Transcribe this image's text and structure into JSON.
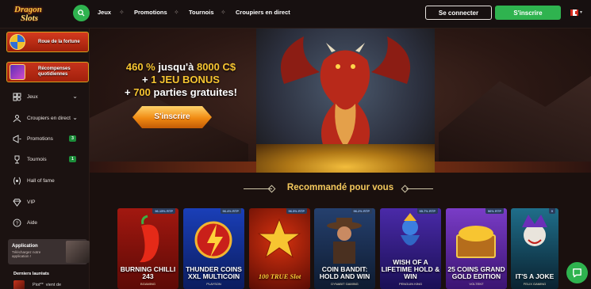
{
  "header": {
    "logo_line1": "Dragon",
    "logo_line2": "Slots",
    "nav": [
      "Jeux",
      "Promotions",
      "Tournois",
      "Croupiers en direct"
    ],
    "login_label": "Se connecter",
    "signup_label": "S'inscrire",
    "language_flag": "canada-flag-icon"
  },
  "sidebar": {
    "wheel_label": "Roue de la fortune",
    "daily_label": "Récompenses quotidiennes",
    "items": [
      {
        "label": "Jeux",
        "icon": "games-icon"
      },
      {
        "label": "Croupiers en direct",
        "icon": "live-dealer-icon"
      },
      {
        "label": "Promotions",
        "icon": "megaphone-icon",
        "badge": "3"
      },
      {
        "label": "Tournois",
        "icon": "trophy-icon",
        "badge": "1"
      },
      {
        "label": "Hall of fame",
        "icon": "laurel-icon"
      },
      {
        "label": "VIP",
        "icon": "diamond-icon"
      },
      {
        "label": "Aide",
        "icon": "help-icon"
      }
    ],
    "app": {
      "title": "Application",
      "subtitle": "Téléchargez notre application !"
    },
    "winners_title": "Derniers lauréats",
    "winner": {
      "name": "Piot**",
      "text": "vient de"
    }
  },
  "hero": {
    "line1_a": "460 %",
    "line1_b": " jusqu'à ",
    "line1_c": "8000 C$",
    "line2_a": "+ ",
    "line2_b": "1 JEU BONUS",
    "line3_a": "+ ",
    "line3_b": "700",
    "line3_c": " parties gratuites!",
    "cta_label": "S'inscrire"
  },
  "recommended": {
    "title": "Recommandé pour vous",
    "games": [
      {
        "title": "BURNING CHILLI 243",
        "provider": "BGAMING",
        "rtp": "96.15% RTP"
      },
      {
        "title": "THUNDER COINS XXL MULTICOIN",
        "provider": "PLAYSON",
        "rtp": "96.4% RTP"
      },
      {
        "title": "100 TRUE Slot",
        "provider": "",
        "rtp": "96.5% RTP"
      },
      {
        "title": "COIN BANDIT: HOLD AND WIN",
        "provider": "DYNABIT GAMING",
        "rtp": "96.2% RTP"
      },
      {
        "title": "WISH OF A LIFETIME HOLD & WIN",
        "provider": "PENGUIN KING",
        "rtp": "95.7% RTP"
      },
      {
        "title": "25 COINS GRAND GOLD EDITION",
        "provider": "VOLTENT",
        "rtp": "96% RTP"
      },
      {
        "title": "IT'S A JOKE",
        "provider": "FELIX GAMING",
        "rtp": "9"
      }
    ]
  },
  "colors": {
    "accent_green": "#2fb34f",
    "gold": "#f7c531",
    "bg": "#1a100e"
  }
}
